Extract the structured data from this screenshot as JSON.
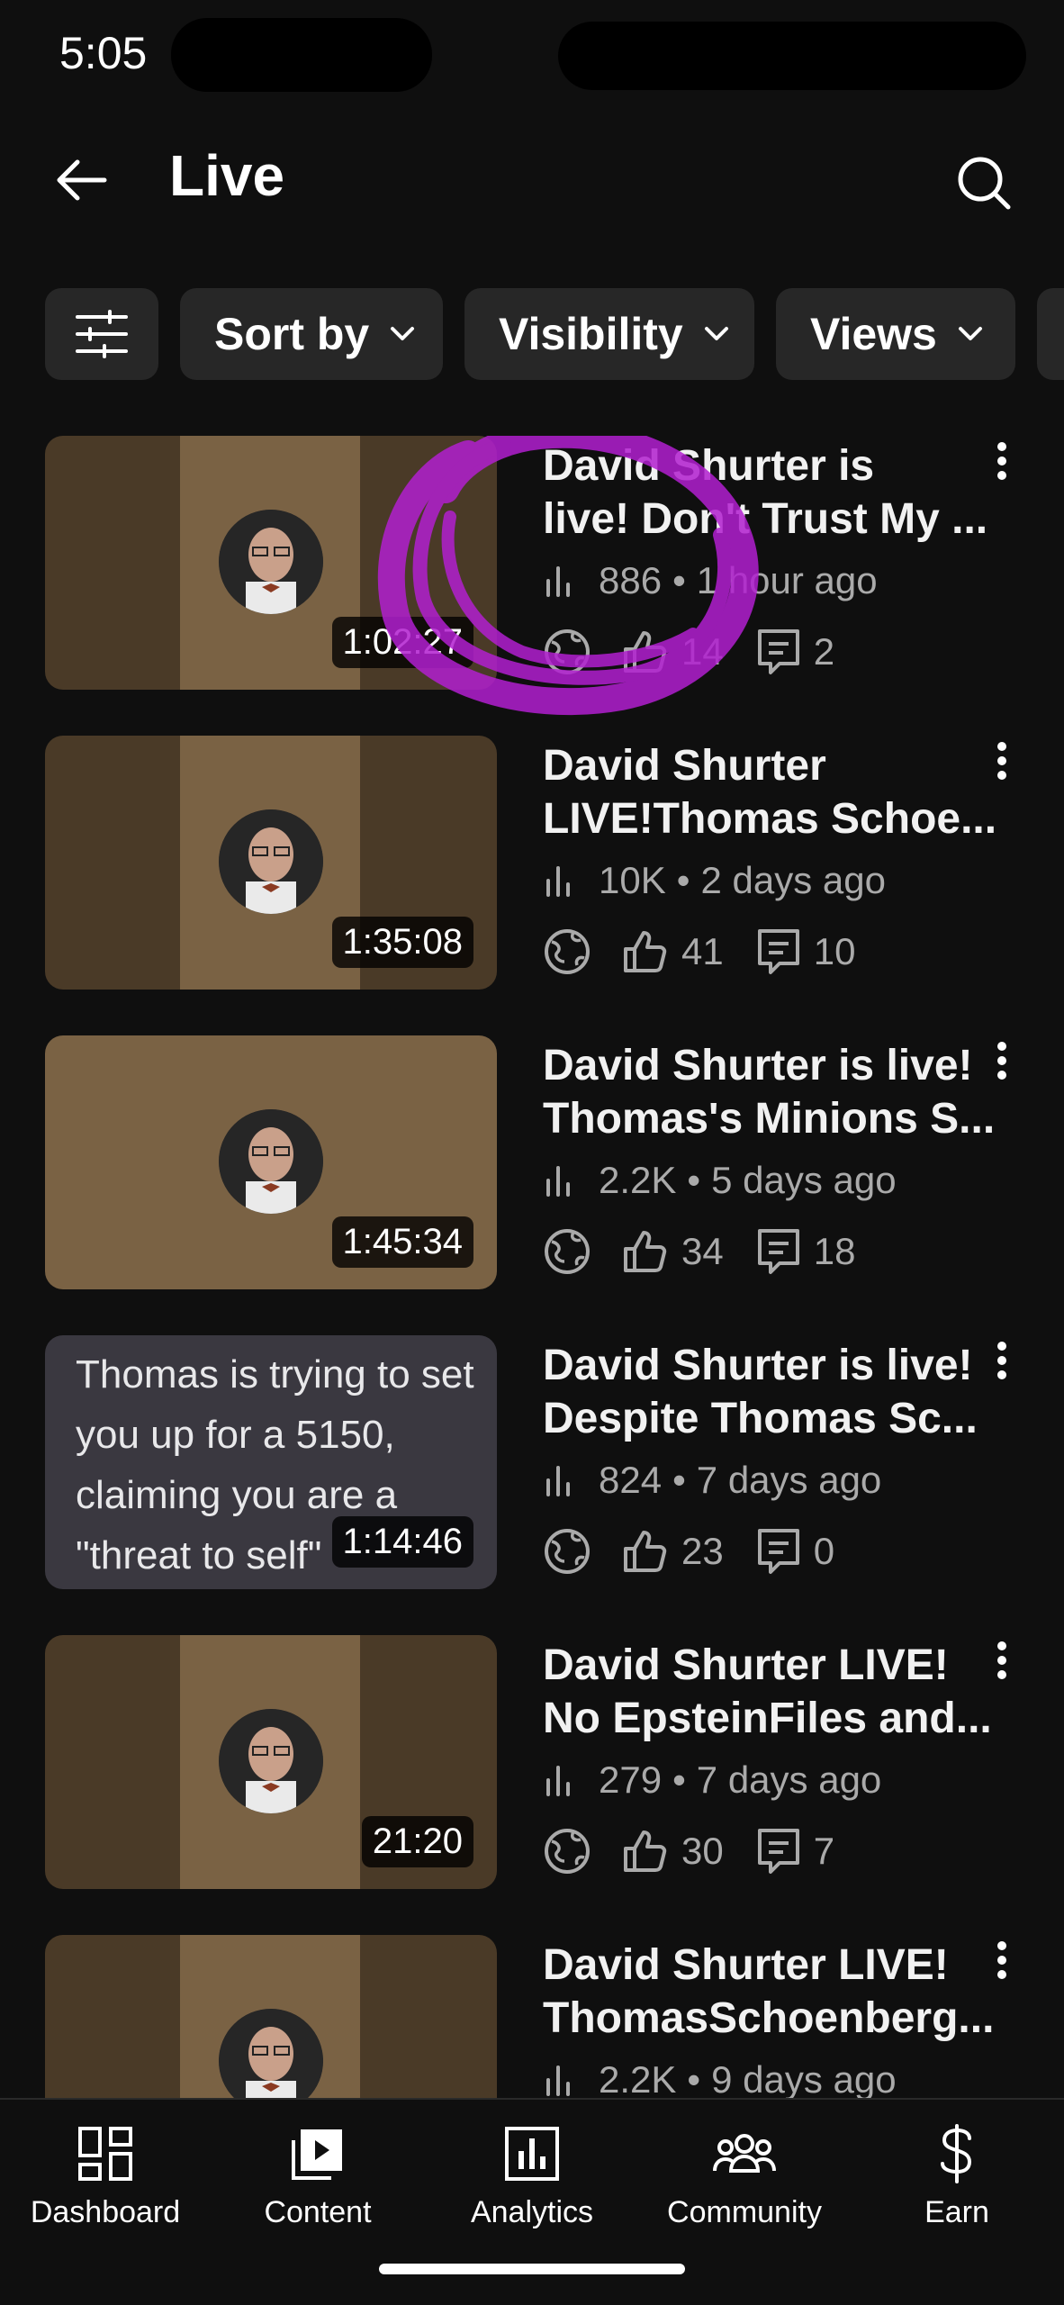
{
  "status_bar": {
    "time": "5:05"
  },
  "header": {
    "title": "Live"
  },
  "filters": {
    "sort_label": "Sort by",
    "visibility_label": "Visibility",
    "views_label": "Views"
  },
  "videos": [
    {
      "title_line1": "David Shurter is",
      "title_line2": "live! Don't Trust My ...",
      "views": "886",
      "age": "1 hour ago",
      "likes": "14",
      "comments": "2",
      "duration": "1:02:27"
    },
    {
      "title_line1": "David Shurter",
      "title_line2": "LIVE!Thomas Schoe...",
      "views": "10K",
      "age": "2 days ago",
      "likes": "41",
      "comments": "10",
      "duration": "1:35:08"
    },
    {
      "title_line1": "David Shurter is live!",
      "title_line2": "Thomas's Minions S...",
      "views": "2.2K",
      "age": "5 days ago",
      "likes": "34",
      "comments": "18",
      "duration": "1:45:34"
    },
    {
      "title_line1": "David Shurter is live!",
      "title_line2": "Despite Thomas Sc...",
      "views": "824",
      "age": "7 days ago",
      "likes": "23",
      "comments": "0",
      "duration": "1:14:46",
      "thumb_text": "Thomas is trying to set you up for a 5150, claiming you are a \"threat to self\""
    },
    {
      "title_line1": "David Shurter LIVE!",
      "title_line2": "No EpsteinFiles and...",
      "views": "279",
      "age": "7 days ago",
      "likes": "30",
      "comments": "7",
      "duration": "21:20"
    },
    {
      "title_line1": "David Shurter LIVE!",
      "title_line2": "ThomasSchoenberg...",
      "views": "2.2K",
      "age": "9 days ago",
      "likes": "",
      "comments": "",
      "duration": ""
    }
  ],
  "bottom_nav": {
    "dashboard": "Dashboard",
    "content": "Content",
    "analytics": "Analytics",
    "community": "Community",
    "earn": "Earn"
  },
  "colors": {
    "background": "#0f0f0f",
    "chip": "#272727",
    "secondary_text": "#aaaaaa",
    "annotation": "#b21fd0"
  }
}
